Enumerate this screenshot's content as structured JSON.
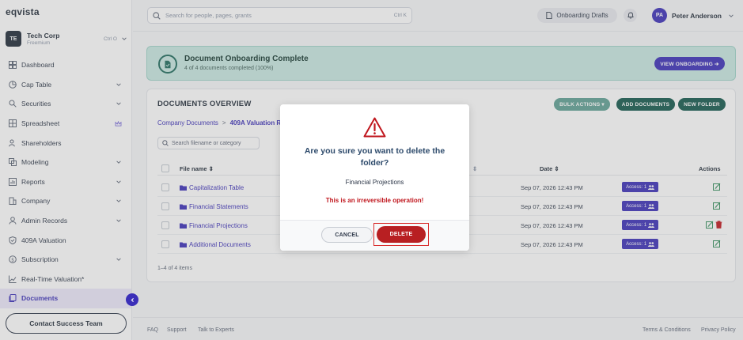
{
  "app": {
    "logo": "eqvista"
  },
  "org": {
    "initials": "TE",
    "name": "Tech Corp",
    "plan": "Freemium",
    "shortcut": "Ctrl O"
  },
  "sidebar": {
    "items": [
      {
        "label": "Dashboard",
        "icon": "dashboard-icon",
        "chevron": false
      },
      {
        "label": "Cap Table",
        "icon": "pie-chart-icon",
        "chevron": true
      },
      {
        "label": "Securities",
        "icon": "securities-icon",
        "chevron": true
      },
      {
        "label": "Spreadsheet",
        "icon": "grid-icon",
        "chevron": false,
        "badge": "crown-icon"
      },
      {
        "label": "Shareholders",
        "icon": "users-icon",
        "chevron": false
      },
      {
        "label": "Modeling",
        "icon": "modeling-icon",
        "chevron": true
      },
      {
        "label": "Reports",
        "icon": "reports-icon",
        "chevron": true
      },
      {
        "label": "Company",
        "icon": "company-icon",
        "chevron": true
      },
      {
        "label": "Admin Records",
        "icon": "admin-icon",
        "chevron": true
      },
      {
        "label": "409A Valuation",
        "icon": "shield-icon",
        "chevron": false
      },
      {
        "label": "Subscription",
        "icon": "subscription-icon",
        "chevron": true
      },
      {
        "label": "Real-Time Valuation*",
        "icon": "trend-icon",
        "chevron": false
      },
      {
        "label": "Documents",
        "icon": "documents-icon",
        "chevron": false,
        "active": true
      }
    ],
    "contact_label": "Contact Success Team"
  },
  "header": {
    "search_placeholder": "Search for people, pages, grants",
    "search_shortcut": "Ctrl K",
    "drafts_label": "Onboarding Drafts",
    "user_initials": "PA",
    "user_name": "Peter Anderson"
  },
  "banner": {
    "title": "Document Onboarding Complete",
    "subtitle": "4 of 4 documents completed (100%)",
    "button": "VIEW ONBOARDING ➔"
  },
  "documents": {
    "title": "DOCUMENTS OVERVIEW",
    "bulk_label": "BULK ACTIONS ▾",
    "add_label": "ADD DOCUMENTS",
    "folder_label": "NEW FOLDER",
    "breadcrumb": {
      "root": "Company Documents",
      "current": "409A Valuation Re"
    },
    "filter_placeholder": "Search filename or category",
    "columns": {
      "name": "File name ⇕",
      "mid": "⇕",
      "date": "Date ⇕",
      "actions": "Actions"
    },
    "rows": [
      {
        "name": "Capitalization Table",
        "date": "Sep 07, 2026 12:43 PM",
        "access": "Access: 1"
      },
      {
        "name": "Financial Statements",
        "date": "Sep 07, 2026 12:43 PM",
        "access": "Access: 1"
      },
      {
        "name": "Financial Projections",
        "date": "Sep 07, 2026 12:43 PM",
        "access": "Access: 1"
      },
      {
        "name": "Additional Documents",
        "date": "Sep 07, 2026 12:43 PM",
        "access": "Access: 1"
      }
    ],
    "pager": "1–4 of 4 items"
  },
  "footer": {
    "faq": "FAQ",
    "support": "Support",
    "experts": "Talk to Experts",
    "terms": "Terms & Conditions",
    "privacy": "Privacy Policy"
  },
  "modal": {
    "question": "Are you sure you want to delete the folder?",
    "item": "Financial Projections",
    "warning": "This is an irreversible operation!",
    "cancel": "CANCEL",
    "delete": "DELETE"
  },
  "colors": {
    "brand": "#3b2fb8",
    "teal": "#13594c",
    "danger": "#b81f22",
    "banner_bg": "#c9e8e2"
  }
}
